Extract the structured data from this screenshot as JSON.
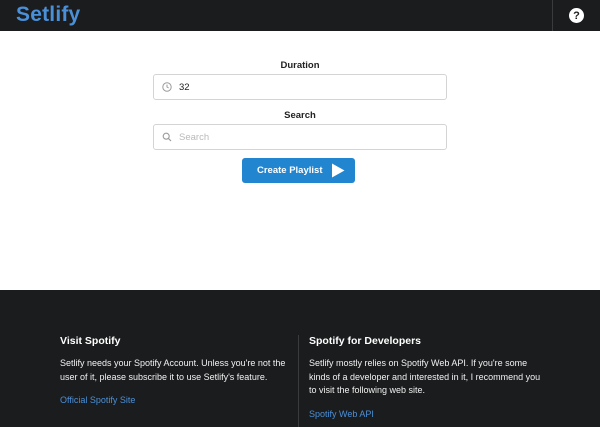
{
  "header": {
    "brand": "Setlify",
    "help_icon": "question-circle-icon"
  },
  "form": {
    "duration_label": "Duration",
    "duration_value": "32",
    "duration_icon": "clock-icon",
    "search_label": "Search",
    "search_placeholder": "Search",
    "search_value": "",
    "search_icon": "search-icon",
    "create_button_label": "Create Playlist",
    "create_button_icon": "play-icon"
  },
  "footer": {
    "left": {
      "title": "Visit Spotify",
      "text": "Setlify needs your Spotify Account. Unless you're not the user of it, please subscribe it to use Setlify's feature.",
      "link": "Official Spotify Site"
    },
    "right": {
      "title": "Spotify for Developers",
      "text": "Setlify mostly relies on Spotify Web API. If you're some kinds of a developer and interested in it, I recommend you to visit the following web site.",
      "link": "Spotify Web API"
    }
  },
  "colors": {
    "brand": "#4a90d9",
    "dark": "#1b1c1d",
    "button": "#2185d0"
  }
}
